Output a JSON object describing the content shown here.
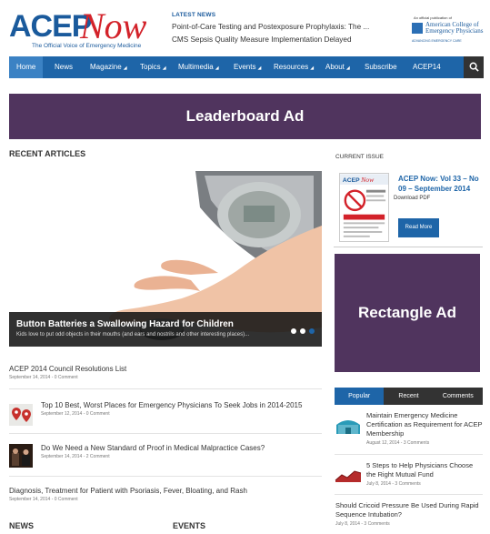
{
  "header": {
    "logo_acep": "ACEP",
    "logo_now": "Now",
    "logo_tagline": "The Official Voice of Emergency Medicine",
    "latest_label": "LATEST NEWS",
    "latest_items": [
      "Point-of-Care Testing and Postexposure Prophylaxis: The ...",
      "CMS Sepsis Quality Measure Implementation Delayed"
    ],
    "badge_small": "An official publication of",
    "badge_name": "American College of Emergency Physicians",
    "badge_sub": "ADVANCING EMERGENCY CARE"
  },
  "nav": {
    "items": [
      "Home",
      "News",
      "Magazine",
      "Topics",
      "Multimedia",
      "Events",
      "Resources",
      "About",
      "Subscribe",
      "ACEP14"
    ],
    "active": "Home"
  },
  "ads": {
    "leaderboard": "Leaderboard Ad",
    "rectangle": "Rectangle Ad"
  },
  "recent": {
    "heading": "RECENT ARTICLES",
    "slider": {
      "title": "Button Batteries a Swallowing Hazard for Children",
      "subtitle": "Kids love to put odd objects in their mouths (and ears and nostrils and other interesting places)..."
    },
    "articles": [
      {
        "title": "ACEP 2014 Council Resolutions List",
        "meta": "September 14, 2014 - 0 Comment"
      },
      {
        "title": "Top 10 Best, Worst Places for Emergency Physicians To Seek Jobs in 2014-2015",
        "meta": "September 12, 2014 - 0 Comment"
      },
      {
        "title": "Do We Need a New Standard of Proof in Medical Malpractice Cases?",
        "meta": "September 14, 2014 - 2 Comment"
      },
      {
        "title": "Diagnosis, Treatment for Patient with Psoriasis, Fever, Bloating, and Rash",
        "meta": "September 14, 2014 - 0 Comment"
      }
    ],
    "news_heading": "NEWS",
    "events_heading": "EVENTS"
  },
  "sidebar": {
    "current_issue_heading": "CURRENT ISSUE",
    "issue_title": "ACEP Now: Vol 33 – No 09 – September 2014",
    "download_pdf": "Download PDF",
    "read_more": "Read More",
    "tabs": [
      "Popular",
      "Recent",
      "Comments"
    ],
    "active_tab": "Popular",
    "items": [
      {
        "title": "Maintain Emergency Medicine Certification as Requirement for ACEP Membership",
        "meta": "August 12, 2014 - 3 Comments"
      },
      {
        "title": "5 Steps to Help Physicians Choose the Right Mutual Fund",
        "meta": "July 8, 2014 - 3 Comments"
      },
      {
        "title": "Should Cricoid Pressure Be Used During Rapid Sequence Intubation?",
        "meta": "July 8, 2014 - 3 Comments"
      }
    ]
  },
  "colors": {
    "brand_blue": "#1e65a8",
    "ad_purple": "#50345e",
    "logo_red": "#d3222a"
  }
}
